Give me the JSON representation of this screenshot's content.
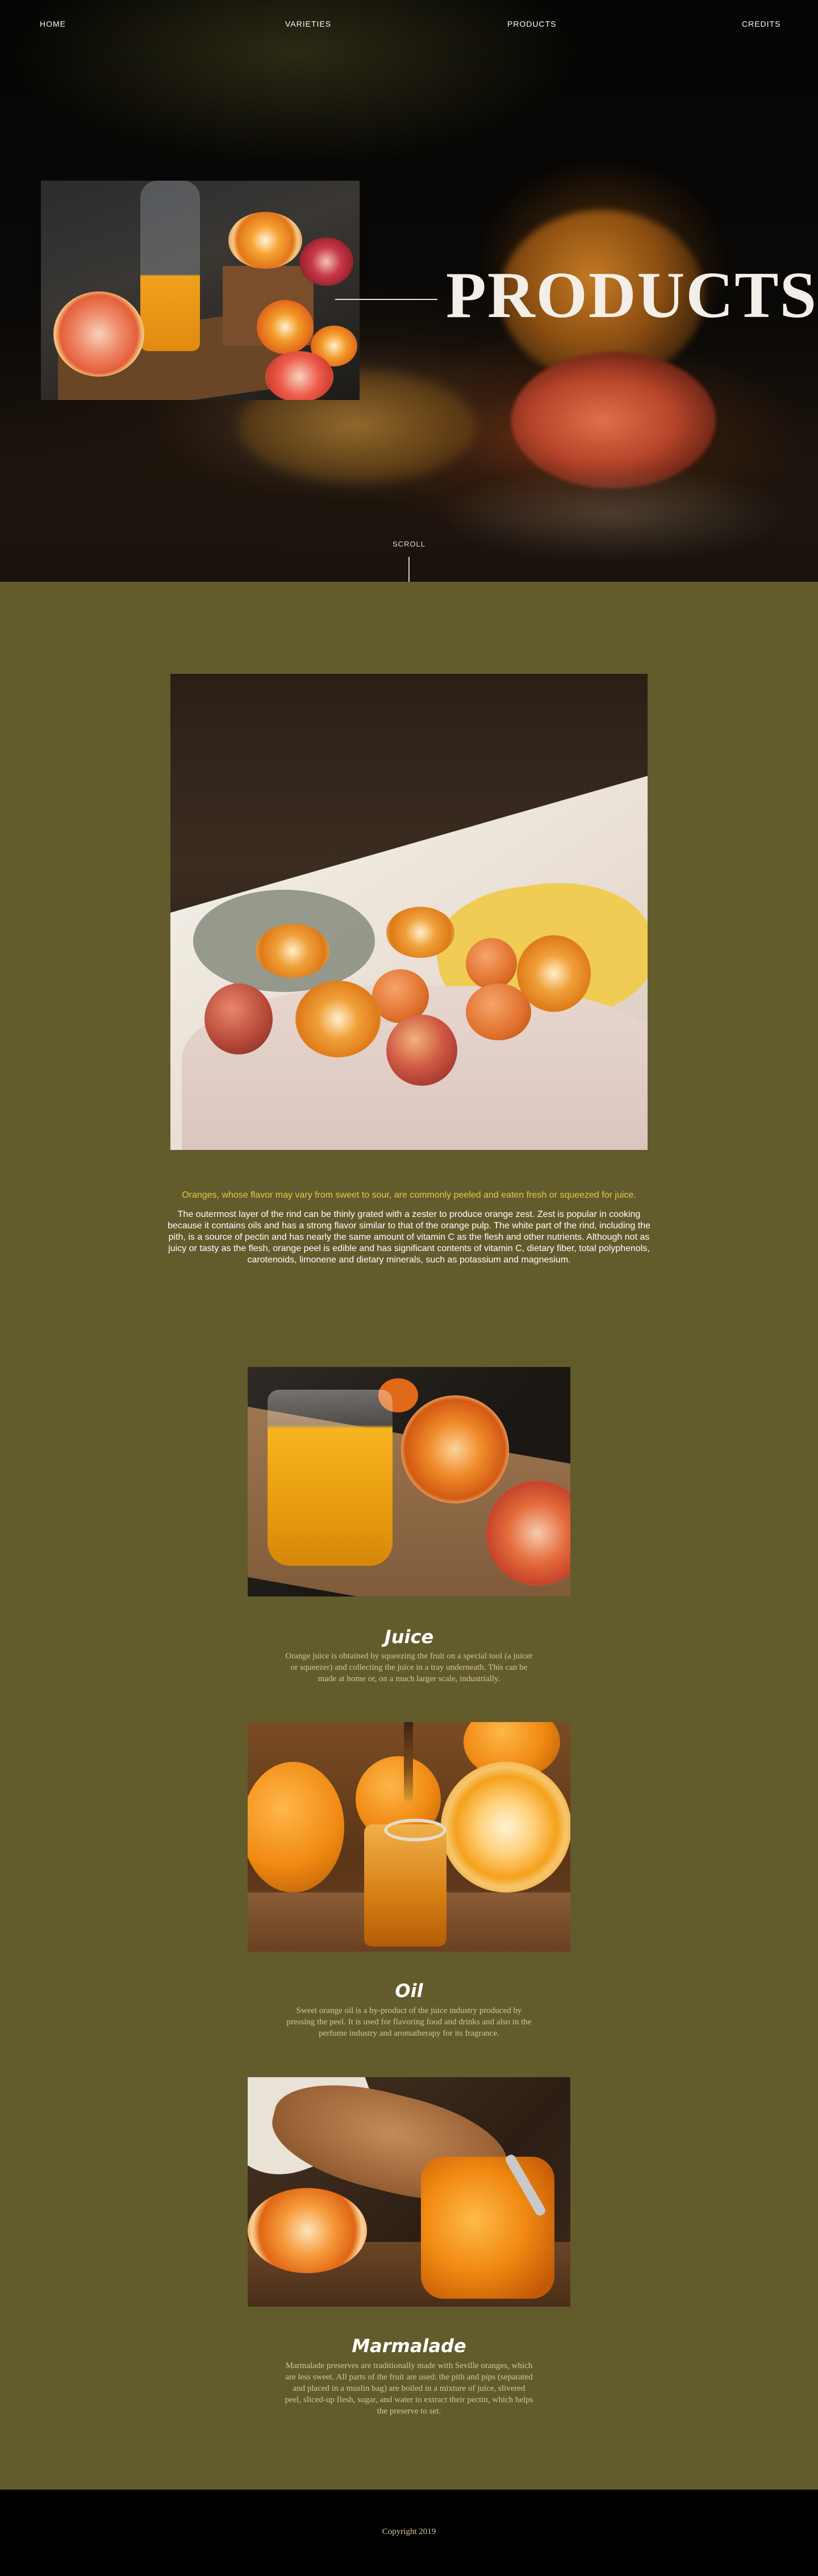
{
  "nav": {
    "home": "HOME",
    "varieties": "VARIETIES",
    "products": "PRODUCTS",
    "credits": "CREDITS"
  },
  "hero": {
    "title": "PRODUCTS",
    "scroll_label": "SCROLL"
  },
  "intro": {
    "lead": "Oranges, whose flavor may vary from sweet to sour, are commonly peeled and eaten fresh or squeezed for juice.",
    "body": "The outermost layer of the rind can be thinly grated with a zester to produce orange zest. Zest is popular in cooking because it contains oils and has a strong flavor similar to that of the orange pulp. The white part of the rind, including the pith, is a source of pectin and has nearly the same amount of vitamin C as the flesh and other nutrients. Although not as juicy or tasty as the flesh, orange peel is edible and has significant contents of vitamin C, dietary fiber, total polyphenols, carotenoids, limonene and dietary minerals, such as potassium and magnesium."
  },
  "products": [
    {
      "title": "Juice",
      "text": "Orange juice is obtained by squeezing the fruit on a special tool (a juicer or squeezer) and collecting the juice in a tray underneath. This can be made at home or, on a much larger scale, industrially."
    },
    {
      "title": "Oil",
      "text": "Sweet orange oil is a by-product of the juice industry produced by pressing the peel. It is used for flavoring food and drinks and also in the perfume industry and aromatherapy for its fragrance."
    },
    {
      "title": "Marmalade",
      "text": "Marmalade preserves are traditionally made with Seville oranges, which are less sweet. All parts of the fruit are used: the pith and pips (separated and placed in a muslin bag) are boiled in a mixture of juice, slivered peel, sliced-up flesh, sugar, and water to extract their pectin, which helps the preserve to set."
    }
  ],
  "footer": {
    "copyright": "Copyright 2019"
  },
  "colors": {
    "olive_background": "#625b2c",
    "accent_yellow": "#e9c84a",
    "muted_text": "#d6c891",
    "footer_background": "#000000"
  }
}
